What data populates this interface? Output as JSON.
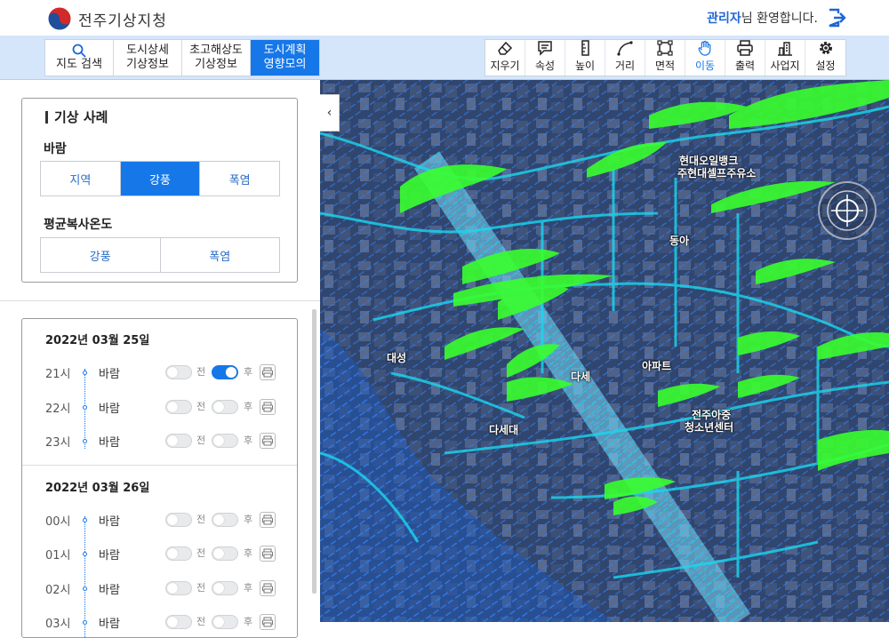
{
  "header": {
    "logo_text": "전주기상지청",
    "welcome_user": "관리자",
    "welcome_suffix": "님 환영합니다."
  },
  "nav_tabs": [
    {
      "line1": "지도 검색",
      "line2": ""
    },
    {
      "line1": "도시상세",
      "line2": "기상정보"
    },
    {
      "line1": "초고해상도",
      "line2": "기상정보"
    },
    {
      "line1": "도시계획",
      "line2": "영향모의"
    }
  ],
  "tools": [
    {
      "label": "지우기",
      "icon": "eraser-icon"
    },
    {
      "label": "속성",
      "icon": "note-icon"
    },
    {
      "label": "높이",
      "icon": "ruler-vertical-icon"
    },
    {
      "label": "거리",
      "icon": "curve-icon"
    },
    {
      "label": "면적",
      "icon": "area-icon"
    },
    {
      "label": "이동",
      "icon": "hand-icon"
    },
    {
      "label": "출력",
      "icon": "printer-icon"
    },
    {
      "label": "사업지",
      "icon": "building-icon"
    },
    {
      "label": "설정",
      "icon": "gear-icon"
    }
  ],
  "case_panel": {
    "title": "기상 사례",
    "wind_label": "바람",
    "wind_options": [
      "지역",
      "강풍",
      "폭염"
    ],
    "wind_selected": "강풍",
    "temp_label": "평균복사온도",
    "temp_options": [
      "강풍",
      "폭염"
    ]
  },
  "timeline": [
    {
      "date": "2022년 03월 25일",
      "rows": [
        {
          "hour": "21시",
          "type": "바람",
          "before": false,
          "after": true
        },
        {
          "hour": "22시",
          "type": "바람",
          "before": false,
          "after": false
        },
        {
          "hour": "23시",
          "type": "바람",
          "before": false,
          "after": false
        }
      ]
    },
    {
      "date": "2022년 03월 26일",
      "rows": [
        {
          "hour": "00시",
          "type": "바람",
          "before": false,
          "after": false
        },
        {
          "hour": "01시",
          "type": "바람",
          "before": false,
          "after": false
        },
        {
          "hour": "02시",
          "type": "바람",
          "before": false,
          "after": false
        },
        {
          "hour": "03시",
          "type": "바람",
          "before": false,
          "after": false
        }
      ]
    }
  ],
  "toggle_labels": {
    "before": "전",
    "after": "후"
  },
  "map_labels": [
    "현대오일뱅크",
    "주현대셀프주유소",
    "동아",
    "아파트",
    "전주아중",
    "청소년센터",
    "다세",
    "대성",
    "다세대"
  ]
}
